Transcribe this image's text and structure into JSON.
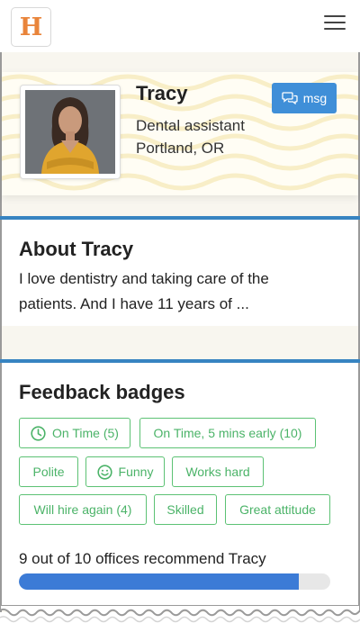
{
  "app": {
    "logo_letter": "H",
    "brand_color": "#e9843a"
  },
  "header": {
    "menu_icon": "hamburger-icon"
  },
  "profile": {
    "name": "Tracy",
    "role": "Dental assistant",
    "location": "Portland, OR",
    "message_button": {
      "label": "msg",
      "icon": "chat-bubbles-icon",
      "color": "#3f8fd8"
    }
  },
  "about": {
    "title": "About Tracy",
    "text_line1": "I love dentistry and taking care of the",
    "text_line2": "patients. And I have 11 years of ..."
  },
  "feedback": {
    "title": "Feedback badges",
    "badge_color": "#5cc274",
    "badges": [
      {
        "label": "On Time (5)",
        "icon": "clock-icon"
      },
      {
        "label": "On Time, 5 mins early (10)"
      },
      {
        "label": "Polite"
      },
      {
        "label": "Funny",
        "icon": "smiley-icon"
      },
      {
        "label": "Works hard"
      },
      {
        "label": "Will hire again (4)"
      },
      {
        "label": "Skilled"
      },
      {
        "label": "Great attitude"
      }
    ],
    "recommend_text": "9 out of 10 offices recommend Tracy",
    "recommend_fraction": 0.9,
    "bar_color": "#3c7bd6"
  }
}
